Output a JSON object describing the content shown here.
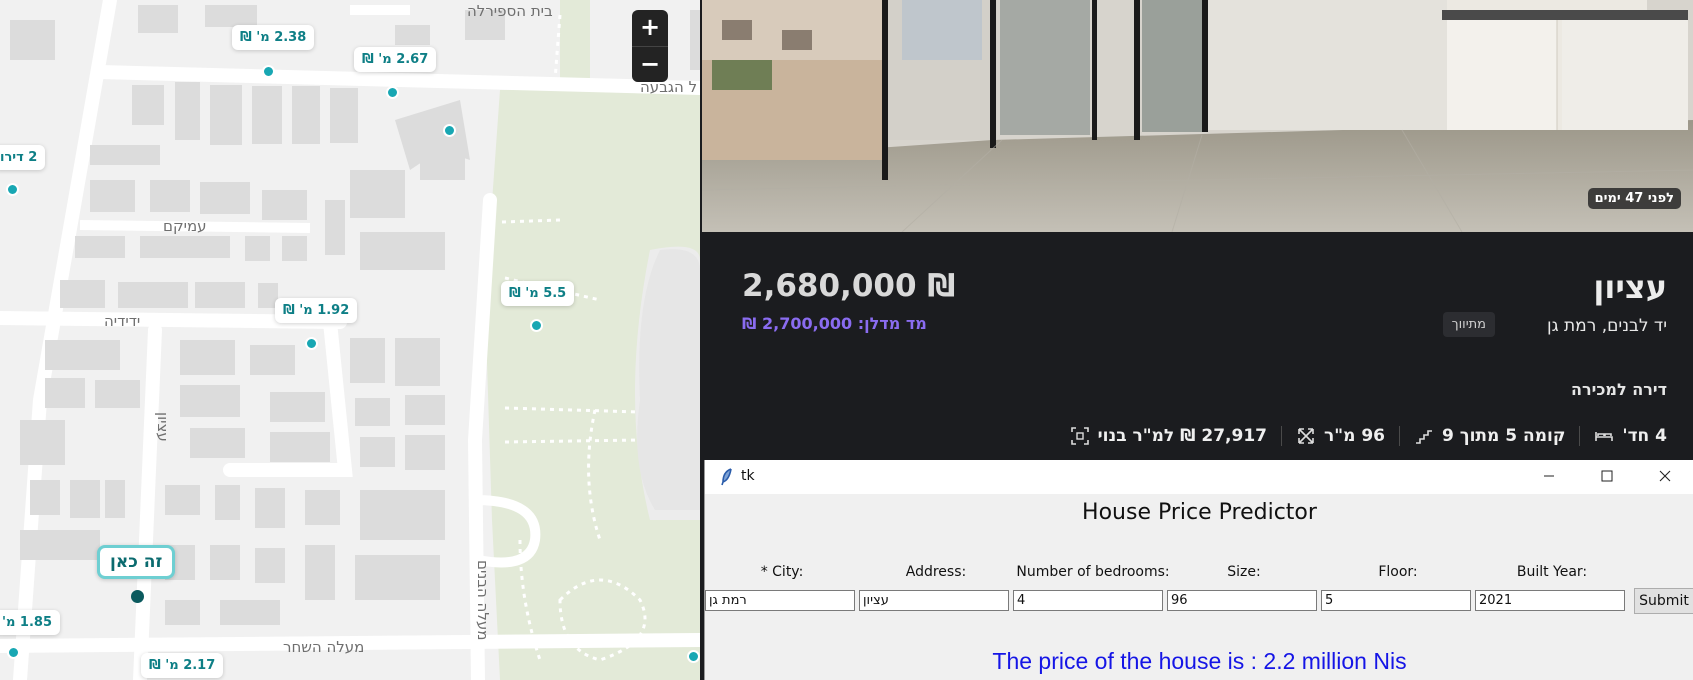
{
  "map": {
    "zoom_in": "+",
    "zoom_out": "−",
    "streets": [
      "בית הספירלה",
      "ל הגבעה",
      "עמיקם",
      "ידידיה",
      "עציון",
      "מעלה השחר",
      "מעלה הבנים"
    ],
    "pins": [
      "2.38 מ' ₪",
      "2.67 מ' ₪",
      "2 דירו",
      "1.92 מ' ₪",
      "5.5 מ' ₪",
      "1.85 מ'",
      "2.17 מ' ₪"
    ],
    "here_label": "זה כאן"
  },
  "listing": {
    "days_badge": "לפני 47 ימים",
    "price": "2,680,000 ₪",
    "madlan_price": "מד מדלן: 2,700,000 ₪",
    "street": "עציון",
    "address": "יד לבנים, רמת גן",
    "renovated_tag": "מתיווך",
    "type": "דירה למכירה",
    "facts": {
      "rooms": "4 חד'",
      "floor": "קומה 5 מתוך 9",
      "size": "96 מ\"ר",
      "price_per_m2": "27,917 ₪ למ\"ר בנוי"
    },
    "icons": [
      "bed-icon",
      "stairs-icon",
      "expand-icon",
      "area-scan-icon"
    ]
  },
  "tk": {
    "window_title": "tk",
    "heading": "House Price Predictor",
    "labels": [
      "* City:",
      "Address:",
      "Number of bedrooms:",
      "Size:",
      "Floor:",
      "Built Year:"
    ],
    "values": [
      "רמת גן",
      "עציון",
      "4",
      "96",
      "5",
      "2021"
    ],
    "submit_label": "Submit",
    "result": "The price of the house is : 2.2 million Nis"
  },
  "colors": {
    "accent_teal": "#18a7b3",
    "madlan_purple": "#8a6cf0",
    "result_blue": "#1515e6",
    "panel_dark": "#1b1c1f"
  }
}
